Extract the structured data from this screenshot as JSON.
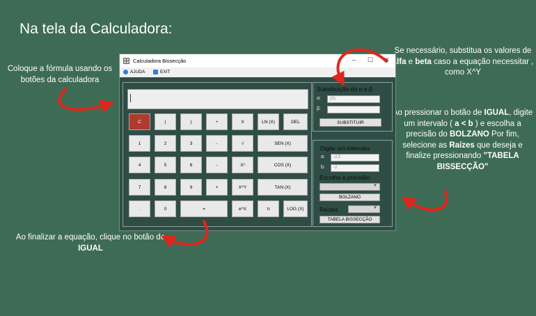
{
  "slide": {
    "title": "Na tela da Calculadora:"
  },
  "notes": {
    "left": "Coloque a fórmula usando os botões da calculadora",
    "top_right": {
      "p1": "Se necessário, substitua os valores de ",
      "b1": "alfa",
      "p2": " e ",
      "b2": "beta",
      "p3": " caso a equação necessitar , como X^Y"
    },
    "right": {
      "p1": "Ao pressionar o botão de ",
      "b1": "IGUAL",
      "p2": ", digite um intervalo ( ",
      "b2": "a < b",
      "p3": " ) e escolha a precisão do ",
      "b3": "BOLZANO",
      "p4": " Por fim, selecione as ",
      "b4": "Raízes",
      "p5": " que deseja e finalize pressionando ",
      "b5": "\"TABELA BISSECÇÃO\""
    },
    "bottom": {
      "p1": "Ao finalizar a equação, clique no botão de ",
      "b1": "IGUAL"
    }
  },
  "window": {
    "title": "Calculadora Bissecção",
    "controls": [
      "–",
      "☐",
      "✕"
    ],
    "menu": [
      {
        "label": "AJUDA",
        "icon": "help-icon",
        "color": "#2f7fd6"
      },
      {
        "label": "EXIT",
        "icon": "exit-icon",
        "color": "#2f7fd6"
      }
    ]
  },
  "calculator": {
    "display_value": "",
    "rows": [
      [
        {
          "label": "C",
          "type": "clear"
        },
        {
          "label": "("
        },
        {
          "label": ")"
        },
        {
          "label": "÷"
        },
        {
          "label": "X"
        },
        {
          "label": "LN (X)"
        },
        {
          "label": "DEL"
        }
      ],
      [
        {
          "label": "1"
        },
        {
          "label": "2"
        },
        {
          "label": "3"
        },
        {
          "label": "-"
        },
        {
          "label": "√"
        },
        {
          "label": "SEN (X)"
        }
      ],
      [
        {
          "label": "4"
        },
        {
          "label": "5"
        },
        {
          "label": "6"
        },
        {
          "label": "-"
        },
        {
          "label": "X²"
        },
        {
          "label": "COS (X)"
        }
      ],
      [
        {
          "label": "7"
        },
        {
          "label": "8"
        },
        {
          "label": "9"
        },
        {
          "label": "+"
        },
        {
          "label": "X^Y"
        },
        {
          "label": "TAN (X)"
        }
      ],
      [
        {
          "label": "."
        },
        {
          "label": "0"
        },
        {
          "label": "="
        },
        {
          "label": "e^X"
        },
        {
          "label": "π"
        },
        {
          "label": "LOG (X)"
        }
      ]
    ]
  },
  "substitution": {
    "title": "Substituição do α e β:",
    "alpha_label": "α:",
    "alpha_value": "(X)",
    "beta_label": "β:",
    "beta_value": "",
    "button": "SUBSTITUIR"
  },
  "interval": {
    "title": "Digite um intervalo:",
    "a_label": "a:",
    "a_value": "-2.5",
    "b_label": "b:",
    "b_value": "-2",
    "precision_label": "Escolha a precisão:",
    "bolzano_button": "BOLZANO",
    "roots_label": "Raízes",
    "table_button": "TABELA BISSECÇÃO"
  },
  "colors": {
    "background": "#3e6b55",
    "window": "#2f4d45",
    "arrow": "#e0261b",
    "clear_button": "#b03a2e"
  }
}
